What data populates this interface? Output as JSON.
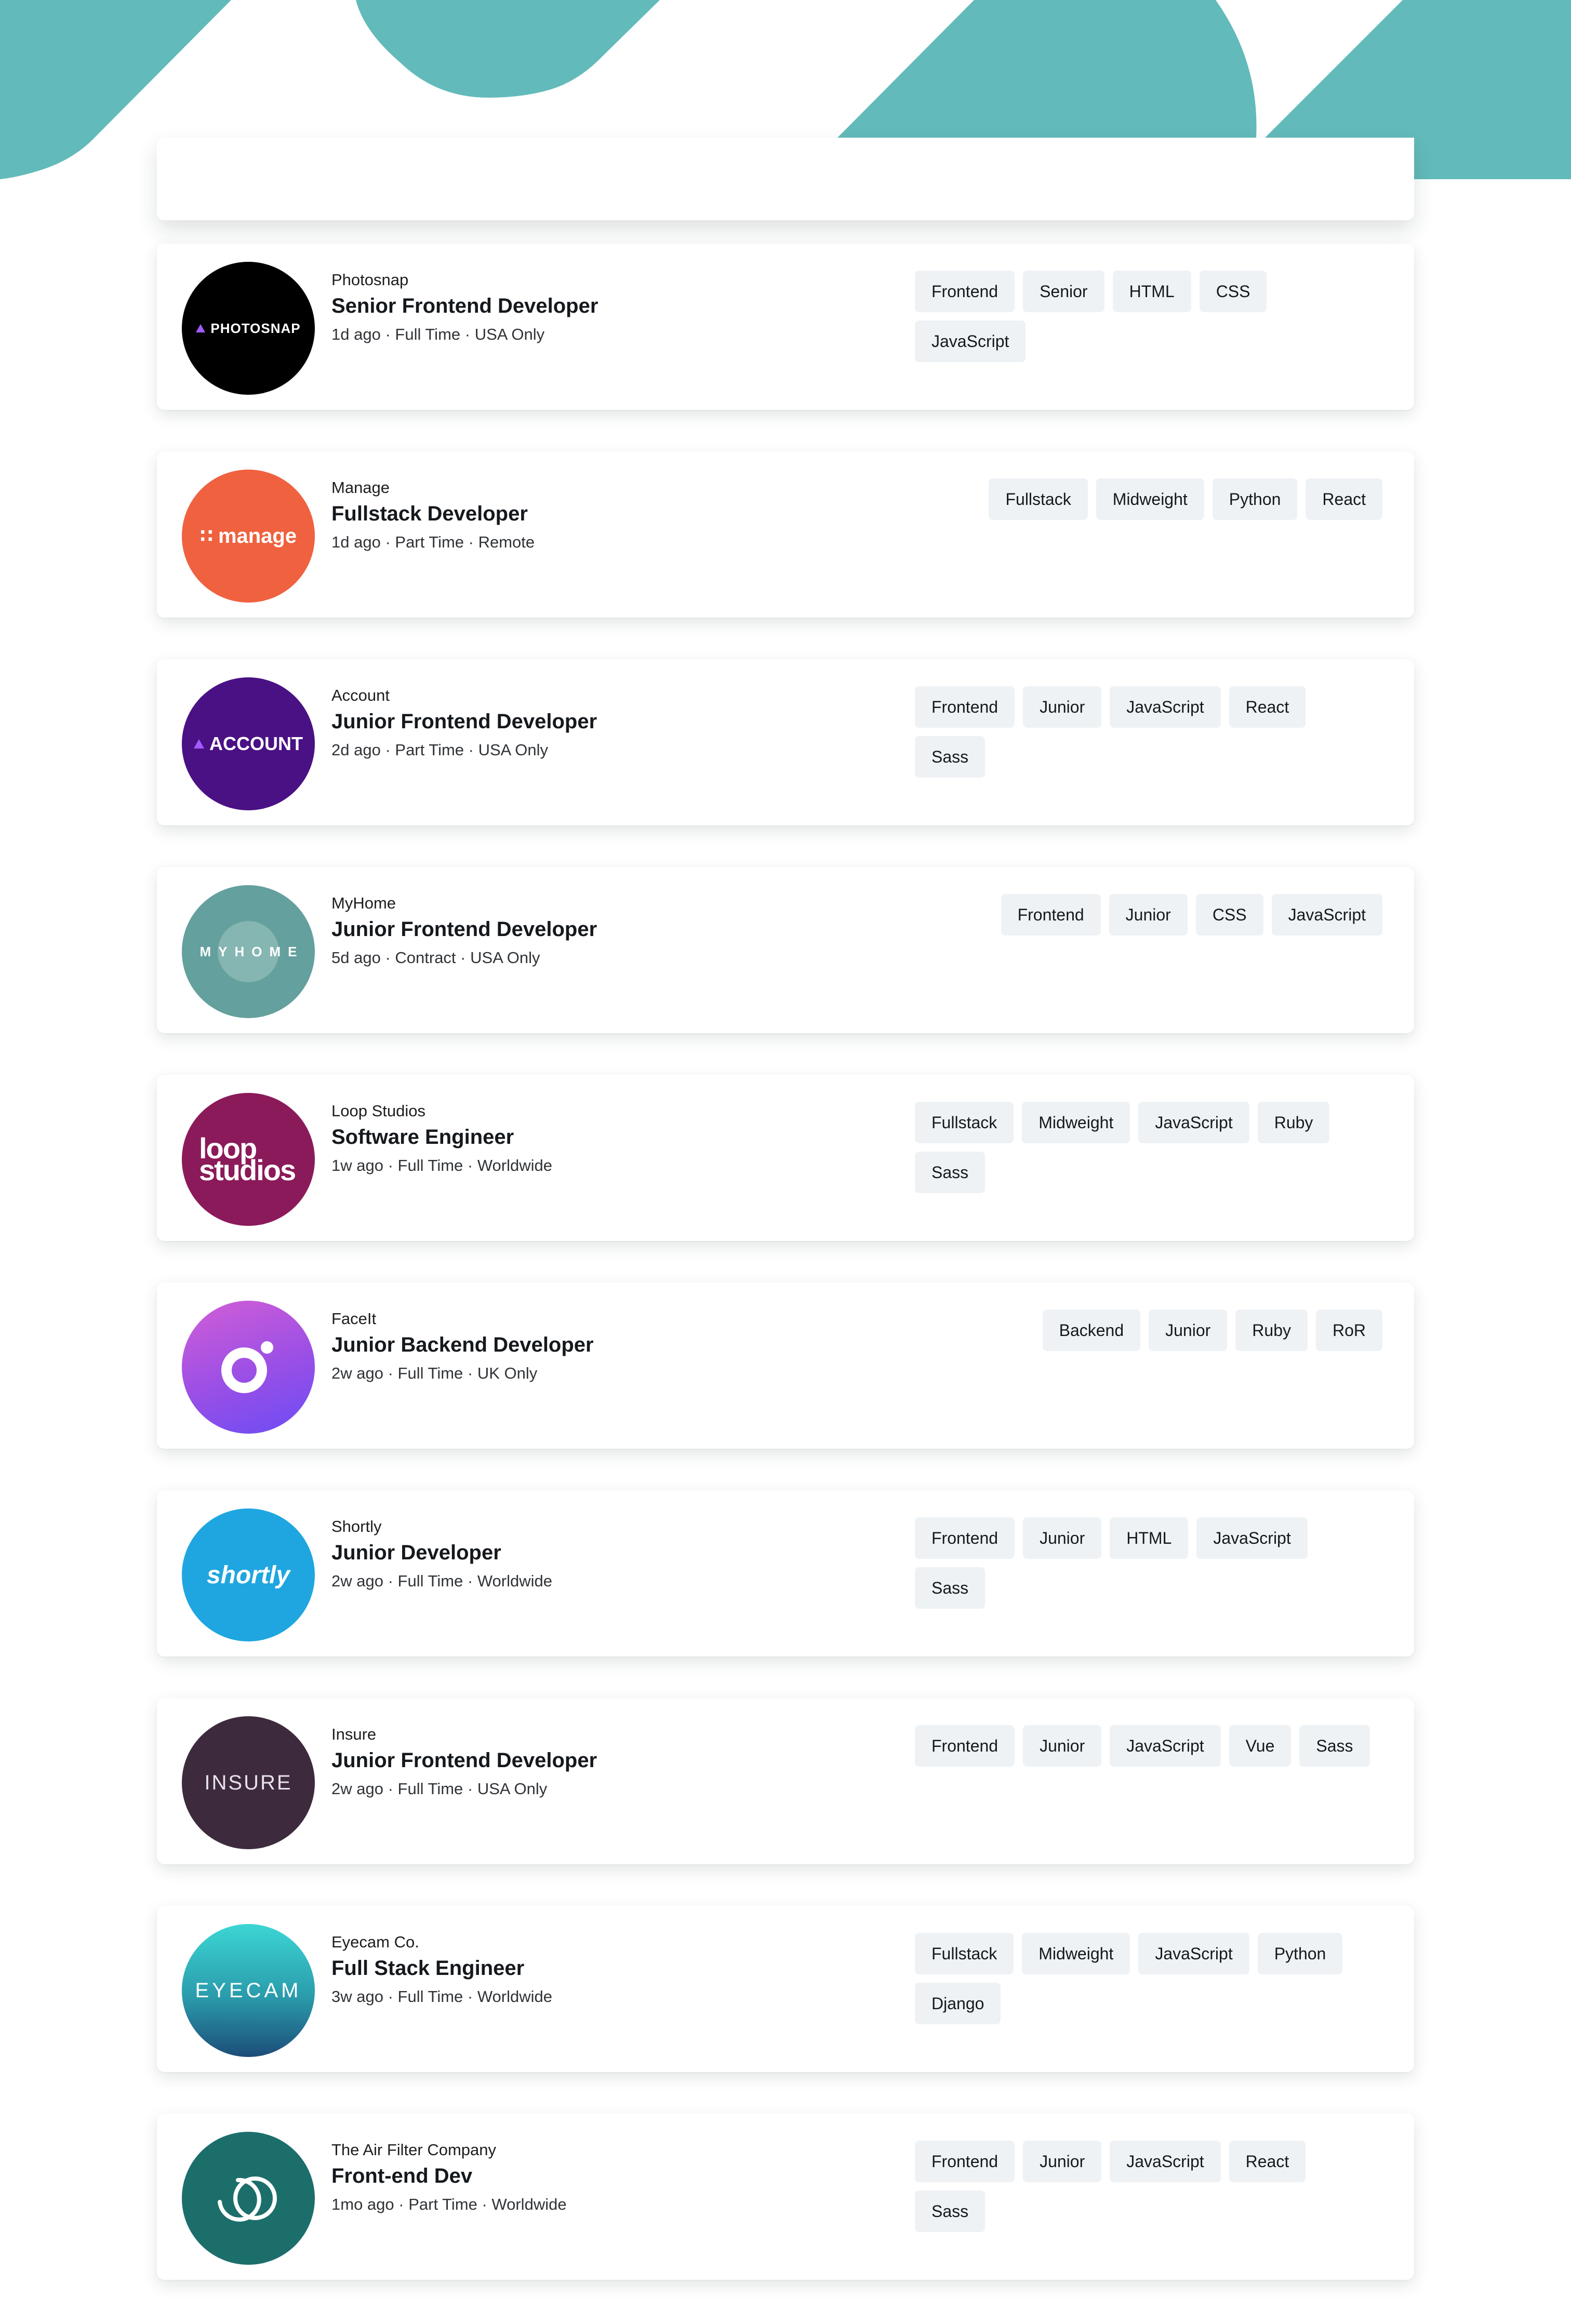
{
  "header": {
    "background_color": "#63baba"
  },
  "filter_bar": {},
  "jobs": [
    {
      "company": "Photosnap",
      "position": "Senior Frontend Developer",
      "posted": "1d ago",
      "contract": "Full Time",
      "location": "USA Only",
      "logo": {
        "text": "PHOTOSNAP",
        "bg": "#000000",
        "icon": "triangle"
      },
      "tags": [
        "Frontend",
        "Senior",
        "HTML",
        "CSS",
        "JavaScript"
      ]
    },
    {
      "company": "Manage",
      "position": "Fullstack Developer",
      "posted": "1d ago",
      "contract": "Part Time",
      "location": "Remote",
      "logo": {
        "text": "manage",
        "bg": "#ef613f",
        "icon": "dots"
      },
      "tags": [
        "Fullstack",
        "Midweight",
        "Python",
        "React"
      ]
    },
    {
      "company": "Account",
      "position": "Junior Frontend Developer",
      "posted": "2d ago",
      "contract": "Part Time",
      "location": "USA Only",
      "logo": {
        "text": "ACCOUNT",
        "bg": "#4a1184",
        "icon": "triangle"
      },
      "tags": [
        "Frontend",
        "Junior",
        "JavaScript",
        "React",
        "Sass"
      ]
    },
    {
      "company": "MyHome",
      "position": "Junior Frontend Developer",
      "posted": "5d ago",
      "contract": "Contract",
      "location": "USA Only",
      "logo": {
        "text": "MYHOME",
        "bg": "#64a09d",
        "icon": "none"
      },
      "tags": [
        "Frontend",
        "Junior",
        "CSS",
        "JavaScript"
      ]
    },
    {
      "company": "Loop Studios",
      "position": "Software Engineer",
      "posted": "1w ago",
      "contract": "Full Time",
      "location": "Worldwide",
      "logo": {
        "text": "loop studios",
        "bg": "#8b1a5a",
        "icon": "none"
      },
      "tags": [
        "Fullstack",
        "Midweight",
        "JavaScript",
        "Ruby",
        "Sass"
      ]
    },
    {
      "company": "FaceIt",
      "position": "Junior Backend Developer",
      "posted": "2w ago",
      "contract": "Full Time",
      "location": "UK Only",
      "logo": {
        "text": "",
        "bg": "#a855e0",
        "icon": "ring"
      },
      "tags": [
        "Backend",
        "Junior",
        "Ruby",
        "RoR"
      ]
    },
    {
      "company": "Shortly",
      "position": "Junior Developer",
      "posted": "2w ago",
      "contract": "Full Time",
      "location": "Worldwide",
      "logo": {
        "text": "shortly",
        "bg": "#1fa6e0",
        "icon": "none"
      },
      "tags": [
        "Frontend",
        "Junior",
        "HTML",
        "JavaScript",
        "Sass"
      ]
    },
    {
      "company": "Insure",
      "position": "Junior Frontend Developer",
      "posted": "2w ago",
      "contract": "Full Time",
      "location": "USA Only",
      "logo": {
        "text": "INSURE",
        "bg": "#3d2b3d",
        "icon": "none"
      },
      "tags": [
        "Frontend",
        "Junior",
        "JavaScript",
        "Vue",
        "Sass"
      ]
    },
    {
      "company": "Eyecam Co.",
      "position": "Full Stack Engineer",
      "posted": "3w ago",
      "contract": "Full Time",
      "location": "Worldwide",
      "logo": {
        "text": "EYECAM",
        "bg": "#2a9bab",
        "icon": "none"
      },
      "tags": [
        "Fullstack",
        "Midweight",
        "JavaScript",
        "Python",
        "Django"
      ]
    },
    {
      "company": "The Air Filter Company",
      "position": "Front-end Dev",
      "posted": "1mo ago",
      "contract": "Part Time",
      "location": "Worldwide",
      "logo": {
        "text": "",
        "bg": "#1c6e6b",
        "icon": "rings"
      },
      "tags": [
        "Frontend",
        "Junior",
        "JavaScript",
        "React",
        "Sass"
      ]
    }
  ]
}
